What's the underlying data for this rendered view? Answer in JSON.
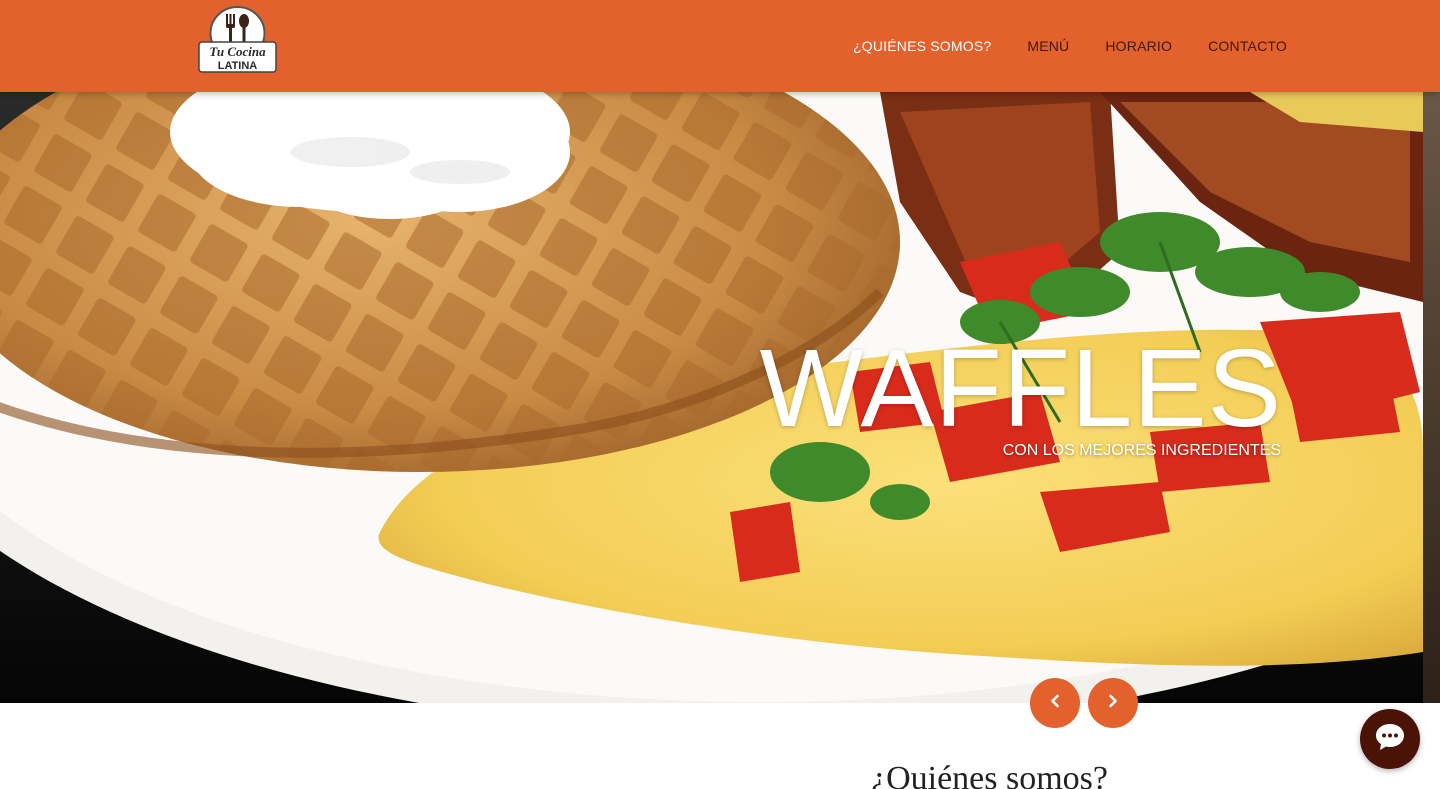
{
  "header": {
    "logo_text_line1": "Tu Cocina",
    "logo_text_line2": "LATINA",
    "nav": [
      {
        "label": "¿QUIÉNES SOMOS?",
        "active": true
      },
      {
        "label": "MENÚ",
        "active": false
      },
      {
        "label": "HORARIO",
        "active": false
      },
      {
        "label": "CONTACTO",
        "active": false
      }
    ]
  },
  "hero": {
    "title": "WAFFLES",
    "subtitle": "CON LOS MEJORES INGREDIENTES",
    "prev_icon": "chevron-left-icon",
    "next_icon": "chevron-right-icon"
  },
  "section": {
    "title": "¿Quiénes somos?"
  },
  "chat": {
    "icon": "chat-bubble-icon"
  },
  "colors": {
    "brand": "#e2612d",
    "nav_text": "#3d1a0c",
    "chat": "#4a1305"
  }
}
